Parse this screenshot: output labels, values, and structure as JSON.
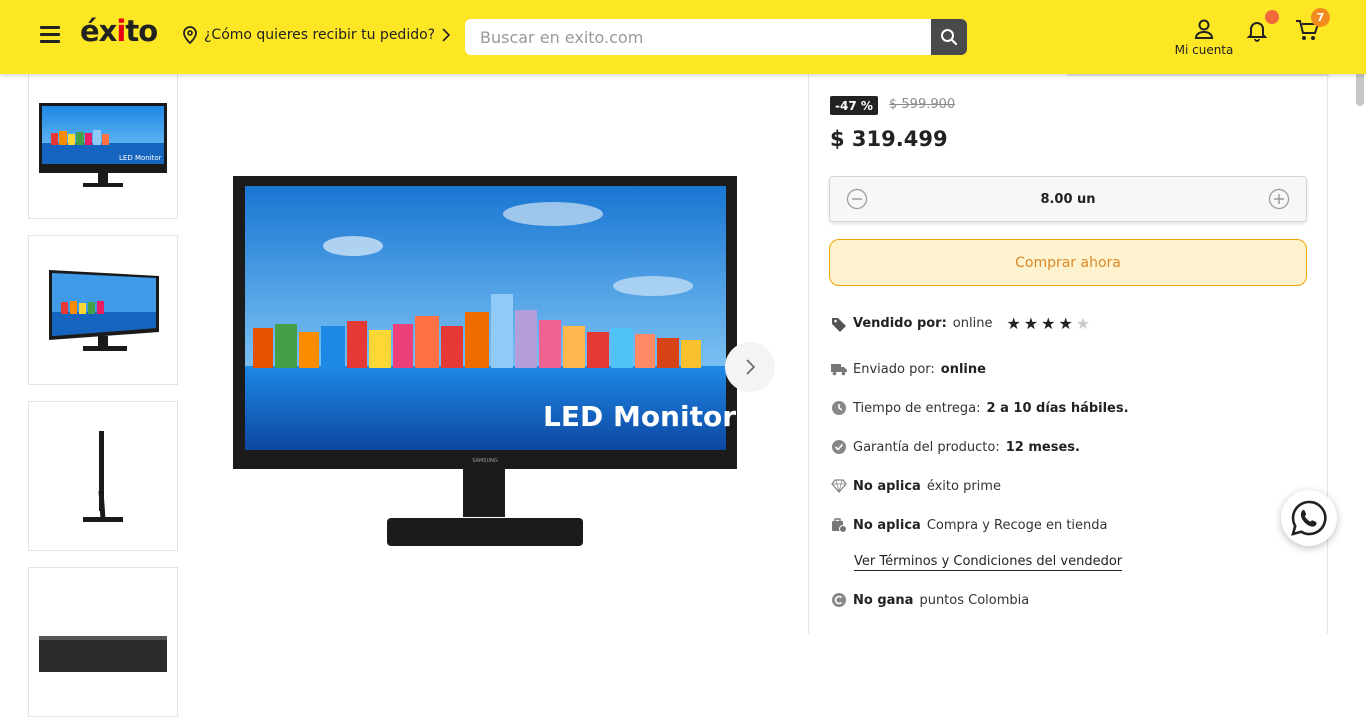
{
  "header": {
    "logo": "éxito",
    "location_prompt": "¿Cómo quieres recibir tu pedido?",
    "search_placeholder": "Buscar en exito.com",
    "account_label": "Mi cuenta",
    "cart_count": "7",
    "colors": {
      "bar": "#fde725",
      "cart_badge": "#f28c1e",
      "notification_dot": "#f06a3b"
    }
  },
  "gallery": {
    "thumbnails": [
      "front-view",
      "angled-view",
      "side-view",
      "back-view"
    ],
    "main_image_text": "LED Monitor",
    "brand": "SAMSUNG"
  },
  "product": {
    "discount": "-47 %",
    "old_price": "$ 599.900",
    "price": "$ 319.499",
    "quantity": "8.00 un",
    "buy_button": "Comprar ahora",
    "seller_label": "Vendido por:",
    "seller": "online",
    "rating": 4,
    "rating_max": 5,
    "shipped_label": "Enviado por:",
    "shipped_by": "online",
    "delivery_label": "Tiempo de entrega:",
    "delivery_time": "2 a 10 días hábiles.",
    "warranty_label": "Garantía del producto:",
    "warranty": "12 meses.",
    "prime_bold": "No aplica",
    "prime_text": "éxito prime",
    "pickup_bold": "No aplica",
    "pickup_text": "Compra y Recoge en tienda",
    "terms_link": "Ver Términos y Condiciones del vendedor",
    "points_bold": "No gana",
    "points_text": "puntos Colombia"
  }
}
